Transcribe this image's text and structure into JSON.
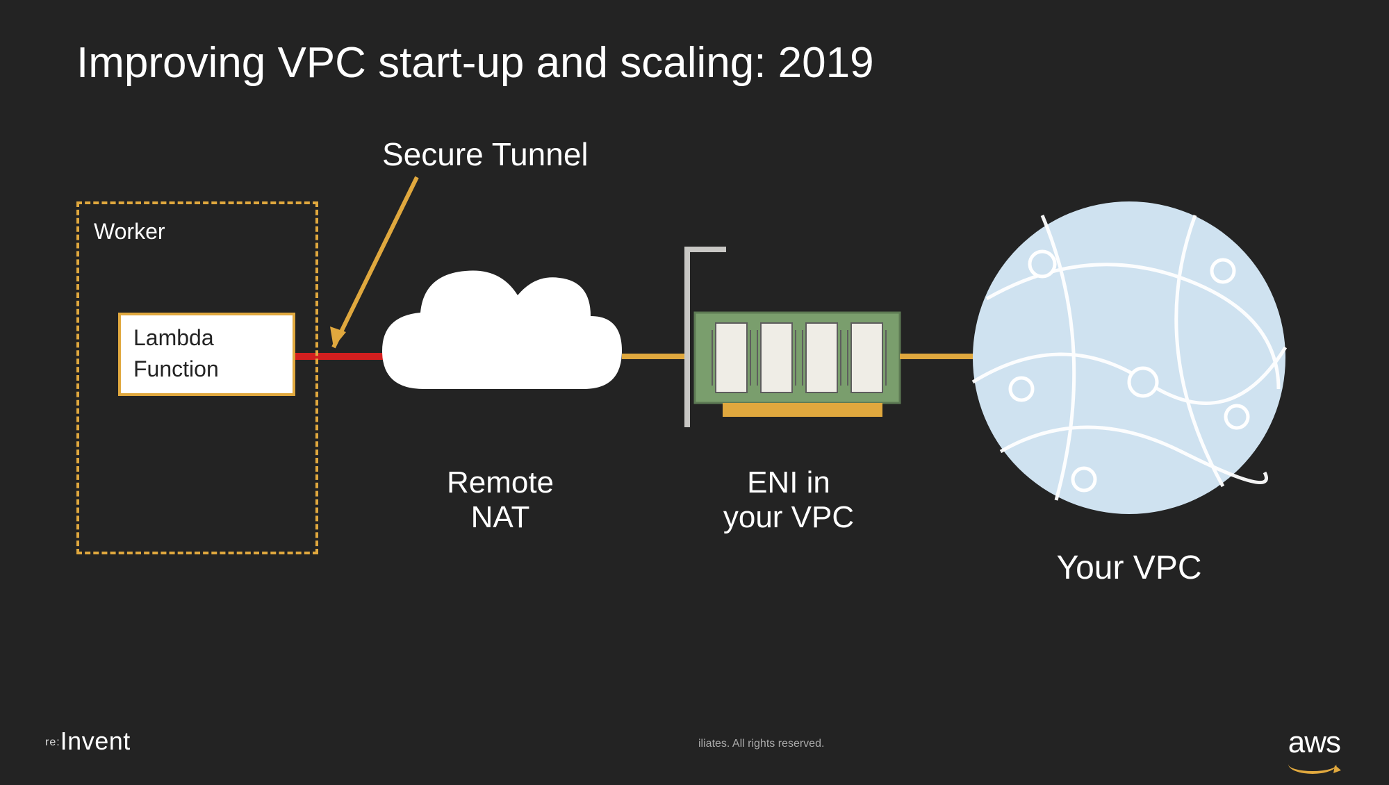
{
  "title": "Improving VPC start-up and scaling: 2019",
  "worker": {
    "label": "Worker",
    "lambda_line1": "Lambda",
    "lambda_line2": "Function"
  },
  "tunnel": {
    "label": "Secure Tunnel"
  },
  "nat": {
    "label_line1": "Remote",
    "label_line2": "NAT"
  },
  "eni": {
    "label_line1": "ENI in",
    "label_line2": "your VPC"
  },
  "vpc": {
    "label": "Your VPC"
  },
  "footer": {
    "left_prefix": "re:",
    "left_word": "Invent",
    "center": "iliates. All rights reserved.",
    "right": "aws"
  },
  "colors": {
    "bg": "#232323",
    "accent": "#e0a83e",
    "red": "#d31f1f",
    "cloud": "#ffffff",
    "eni_board": "#7a9e6d",
    "vpc_fill": "#cfe2f0",
    "vpc_stroke": "#ffffff"
  }
}
